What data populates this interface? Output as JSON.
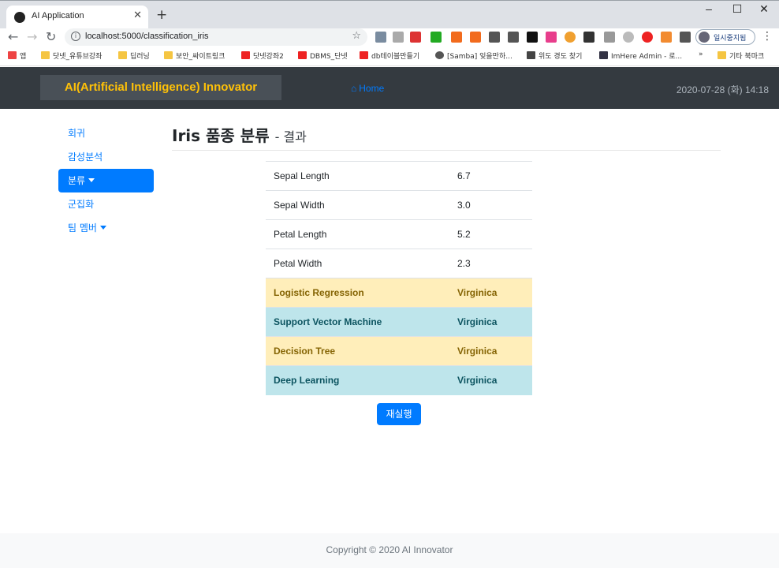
{
  "browser": {
    "tab_title": "AI Application",
    "url": "localhost:5000/classification_iris",
    "profile_name": "일시중지됨",
    "bookmarks": [
      "앱",
      "닷넷_유튜브강좌",
      "딥러닝",
      "보안_싸이트링크",
      "닷넷강좌2",
      "DBMS_단넷",
      "db테이블만들기",
      "[Samba] 잊을만하...",
      "위도 경도 찾기",
      "ImHere Admin - 로...",
      "»",
      "기타 북마크"
    ]
  },
  "navbar": {
    "brand": "AI(Artificial Intelligence) Innovator",
    "home": "Home",
    "datetime": "2020-07-28 (화) 14:18"
  },
  "sidebar": {
    "items": [
      {
        "label": "회귀"
      },
      {
        "label": "감성분석"
      },
      {
        "label": "분류"
      },
      {
        "label": "군집화"
      },
      {
        "label": "팀 멤버"
      }
    ]
  },
  "main": {
    "title": "Iris 품종 분류",
    "subtitle": "- 결과",
    "rows": [
      {
        "label": "Sepal Length",
        "value": "6.7"
      },
      {
        "label": "Sepal Width",
        "value": "3.0"
      },
      {
        "label": "Petal Length",
        "value": "5.2"
      },
      {
        "label": "Petal Width",
        "value": "2.3"
      },
      {
        "label": "Logistic Regression",
        "value": "Virginica"
      },
      {
        "label": "Support Vector Machine",
        "value": "Virginica"
      },
      {
        "label": "Decision Tree",
        "value": "Virginica"
      },
      {
        "label": "Deep Learning",
        "value": "Virginica"
      }
    ],
    "rerun": "재실행"
  },
  "footer": {
    "copyright": "Copyright © 2020 AI Innovator"
  },
  "colors": {
    "navbar": "#343a40",
    "brand_text": "#ffc107",
    "primary": "#007bff",
    "warning_bg": "#ffeeba",
    "info_bg": "#bee5eb"
  }
}
